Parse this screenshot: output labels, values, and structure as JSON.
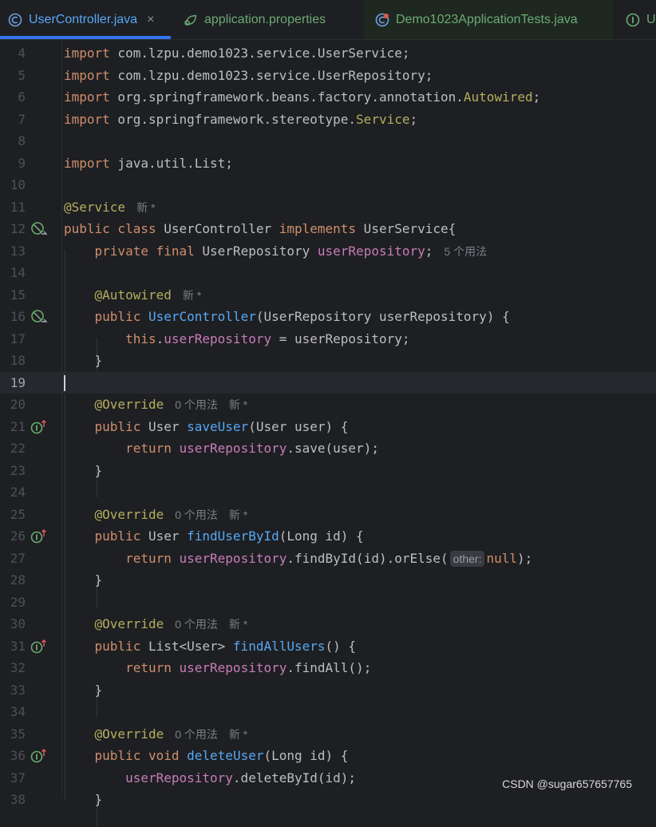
{
  "tabs": [
    {
      "label": "UserController.java",
      "icon": "class-icon",
      "active": true,
      "color": "#56a8f5"
    },
    {
      "label": "application.properties",
      "icon": "spring-leaf-icon",
      "active": false,
      "color": "#6aab73"
    },
    {
      "label": "Demo1023ApplicationTests.java",
      "icon": "test-class-icon",
      "active": false,
      "color": "#6aab73"
    },
    {
      "label": "Us",
      "icon": "interface-icon",
      "active": false,
      "color": "#6aab73"
    }
  ],
  "editor": {
    "line_numbers": [
      "4",
      "5",
      "6",
      "7",
      "8",
      "9",
      "10",
      "11",
      "12",
      "13",
      "14",
      "15",
      "16",
      "17",
      "18",
      "19",
      "20",
      "21",
      "22",
      "23",
      "24",
      "25",
      "26",
      "27",
      "28",
      "29",
      "30",
      "31",
      "32",
      "33",
      "34",
      "35",
      "36",
      "37",
      "38"
    ],
    "current_line": "19",
    "hints": {
      "new_star": "新 *",
      "five_usages": "5 个用法",
      "zero_usages": "0 个用法",
      "param_other": "other:"
    },
    "lines": {
      "l4": {
        "kw": "import",
        "rest": " com.lzpu.demo1023.service.UserService;"
      },
      "l5": {
        "kw": "import",
        "rest": " com.lzpu.demo1023.service.UserRepository;"
      },
      "l6": {
        "kw": "import",
        "pre": " org.springframework.beans.factory.annotation.",
        "ann": "Autowired",
        "post": ";"
      },
      "l7": {
        "kw": "import",
        "pre": " org.springframework.stereotype.",
        "ann": "Service",
        "post": ";"
      },
      "l9": {
        "kw": "import",
        "rest": " java.util.List;"
      },
      "l11": {
        "ann": "@Service"
      },
      "l12": {
        "kw1": "public class",
        "mid": " UserController ",
        "kw2": "implements",
        "post": " UserService{"
      },
      "l13": {
        "kw": "private final",
        "mid": " UserRepository ",
        "fld": "userRepository",
        "post": ";"
      },
      "l15": {
        "ann": "@Autowired"
      },
      "l16": {
        "kw": "public",
        "sp": " ",
        "fn": "UserController",
        "post": "(UserRepository userRepository) {"
      },
      "l17": {
        "kw": "this",
        "dot": ".",
        "fld": "userRepository",
        "post": " = userRepository;"
      },
      "l18": {
        "text": "}"
      },
      "l20": {
        "ann": "@Override"
      },
      "l21": {
        "kw": "public",
        "mid": " User ",
        "fn": "saveUser",
        "post": "(User user) {"
      },
      "l22": {
        "kw": "return",
        "sp": " ",
        "fld": "userRepository",
        "post": ".save(user);"
      },
      "l23": {
        "text": "}"
      },
      "l25": {
        "ann": "@Override"
      },
      "l26": {
        "kw": "public",
        "mid": " User ",
        "fn": "findUserById",
        "post": "(Long id) {"
      },
      "l27": {
        "kw": "return",
        "sp": " ",
        "fld": "userRepository",
        "mid": ".findById(id).orElse(",
        "kw2": "null",
        "post": ");"
      },
      "l28": {
        "text": "}"
      },
      "l30": {
        "ann": "@Override"
      },
      "l31": {
        "kw": "public",
        "mid": " List<User> ",
        "fn": "findAllUsers",
        "post": "() {"
      },
      "l32": {
        "kw": "return",
        "sp": " ",
        "fld": "userRepository",
        "post": ".findAll();"
      },
      "l33": {
        "text": "}"
      },
      "l35": {
        "ann": "@Override"
      },
      "l36": {
        "kw": "public void",
        "sp": " ",
        "fn": "deleteUser",
        "post": "(Long id) {"
      },
      "l37": {
        "fld": "userRepository",
        "post": ".deleteById(id);"
      },
      "l38": {
        "text": "}"
      }
    }
  },
  "watermark": "CSDN @sugar657657765",
  "colors": {
    "background": "#1e1f22",
    "keyword": "#cf8e6d",
    "annotation": "#b3ae60",
    "field": "#c77dbb",
    "function": "#56a8f5",
    "text": "#bcbec4",
    "accent": "#3574f0"
  }
}
